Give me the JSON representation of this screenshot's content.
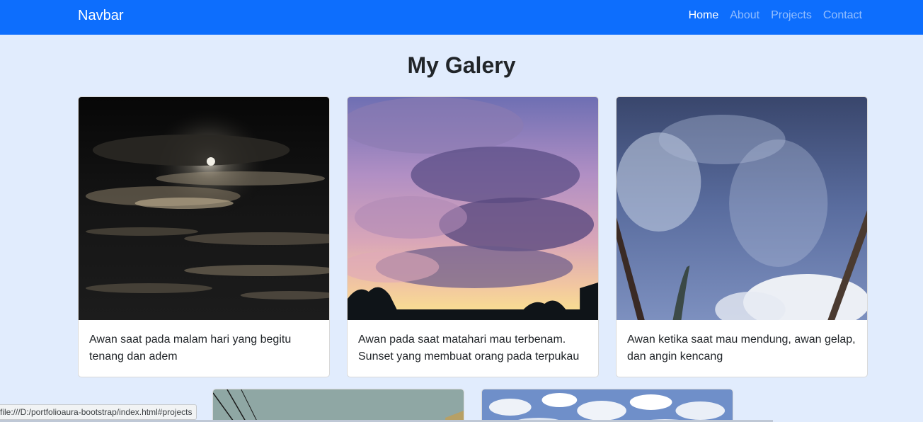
{
  "navbar": {
    "brand": "Navbar",
    "links": [
      {
        "label": "Home",
        "active": true
      },
      {
        "label": "About",
        "active": false
      },
      {
        "label": "Projects",
        "active": false
      },
      {
        "label": "Contact",
        "active": false
      }
    ]
  },
  "gallery": {
    "title": "My Galery",
    "cards": [
      {
        "text": "Awan saat pada malam hari yang begitu tenang dan adem",
        "image": "night-clouds-moon"
      },
      {
        "text": "Awan pada saat matahari mau terbenam. Sunset yang membuat orang pada terpukau",
        "image": "sunset-clouds"
      },
      {
        "text": "Awan ketika saat mau mendung, awan gelap, dan angin kencang",
        "image": "cloudy-sky"
      }
    ],
    "partial_cards": [
      {
        "image": "sky-with-wires"
      },
      {
        "image": "white-clouds"
      }
    ]
  },
  "status_bar": {
    "url": "file:///D:/portfolioaura-bootstrap/index.html#projects"
  },
  "colors": {
    "navbar": "#0d6efd",
    "page_background": "#e1ecfd",
    "text": "#212529"
  }
}
